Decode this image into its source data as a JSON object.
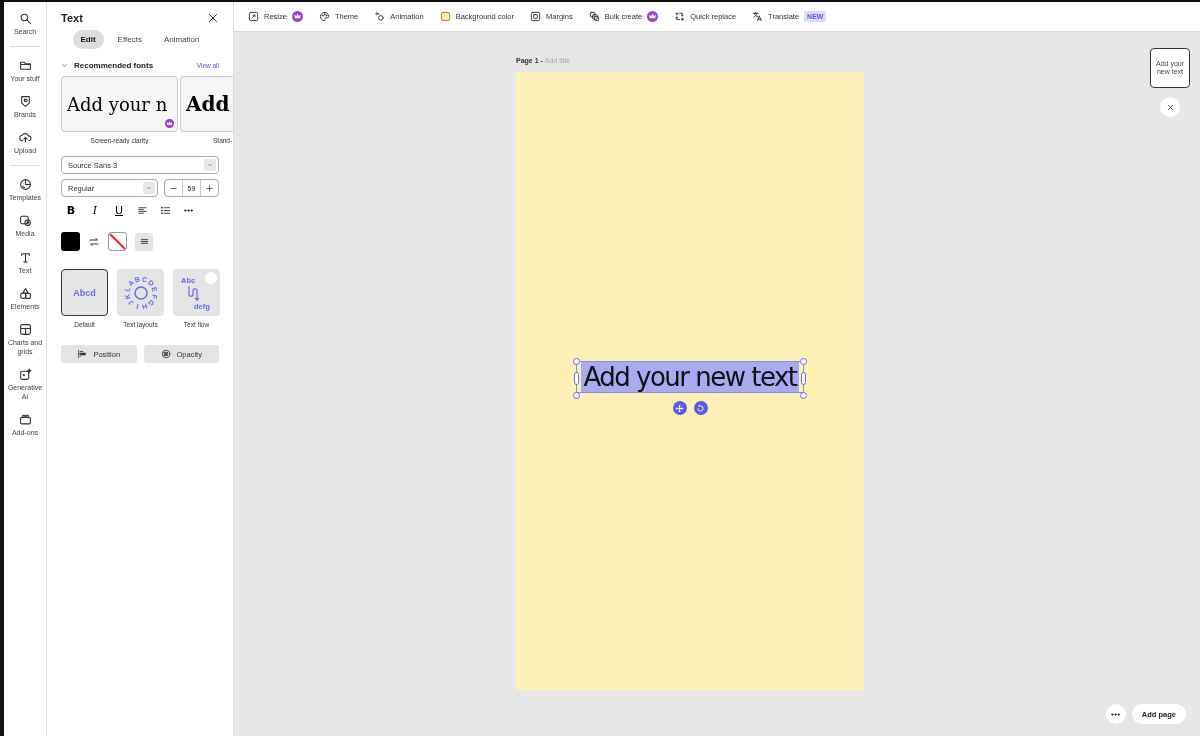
{
  "rail": {
    "items": [
      {
        "label": "Search"
      },
      {
        "label": "Your stuff"
      },
      {
        "label": "Brands"
      },
      {
        "label": "Upload"
      },
      {
        "label": "Templates"
      },
      {
        "label": "Media"
      },
      {
        "label": "Text"
      },
      {
        "label": "Elements"
      },
      {
        "label": "Charts and grids"
      },
      {
        "label": "Generative AI"
      },
      {
        "label": "Add-ons"
      }
    ]
  },
  "panel": {
    "title": "Text",
    "tabs": [
      {
        "label": "Edit",
        "selected": true
      },
      {
        "label": "Effects",
        "selected": false
      },
      {
        "label": "Animation",
        "selected": false
      }
    ],
    "section": {
      "title": "Recommended fonts",
      "expanded": true,
      "link": "View all"
    },
    "font_cards": [
      {
        "sample": "Add your n",
        "caption": "Screen-ready clarity",
        "premium": true,
        "kind": "slab"
      },
      {
        "sample": "Add",
        "caption": "Stand-",
        "premium": false,
        "kind": "heavy"
      }
    ],
    "font_family": {
      "value": "Source Sans 3"
    },
    "font_weight": {
      "value": "Regular"
    },
    "font_size": {
      "value": "59"
    },
    "style_buttons": [
      "B",
      "I",
      "U"
    ],
    "text_color": {
      "color": "#000000"
    },
    "presets": [
      {
        "kind": "default",
        "preview": "Abcd",
        "label": "Default",
        "selected": true
      },
      {
        "kind": "circle",
        "preview_letters": [
          "A",
          "B",
          "C",
          "D",
          "E",
          "F",
          "G",
          "H",
          "I",
          "J",
          "K",
          "L"
        ],
        "label": "Text layouts",
        "selected": false
      },
      {
        "kind": "flow",
        "preview": "Abc",
        "preview_end": "defg",
        "label": "Text flow",
        "selected": false
      }
    ],
    "buttons": [
      "Position",
      "Opacity"
    ]
  },
  "toolbar": [
    {
      "label": "Resize",
      "premium": true
    },
    {
      "label": "Theme",
      "premium": false
    },
    {
      "label": "Animation",
      "premium": false
    },
    {
      "label": "Background color",
      "premium": false
    },
    {
      "label": "Margins",
      "premium": false
    },
    {
      "label": "Bulk create",
      "premium": true
    },
    {
      "label": "Quick replace",
      "premium": false
    },
    {
      "label": "Translate",
      "premium": false,
      "badge": "NEW"
    }
  ],
  "canvas": {
    "page_label": "Page 1 - ",
    "title_placeholder": "Add title",
    "text_box": {
      "text": "Add your new text",
      "selected": true
    },
    "thumbnail": {
      "text": "Add your new text"
    },
    "add_page": "Add page"
  }
}
